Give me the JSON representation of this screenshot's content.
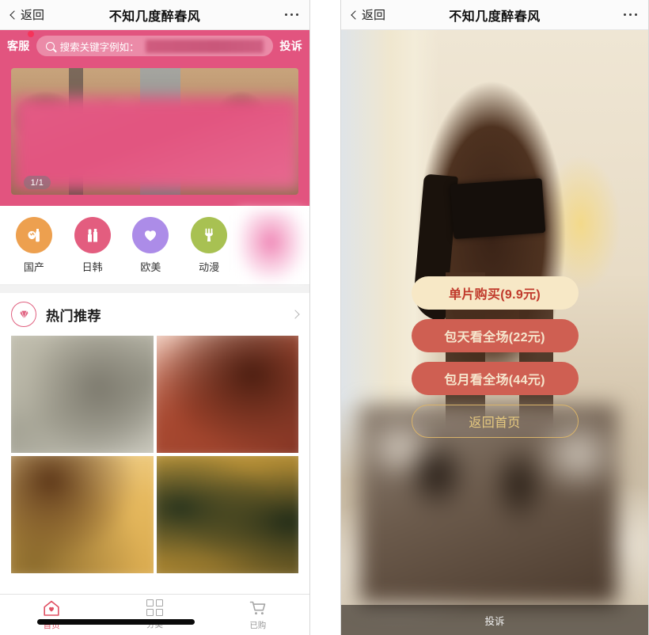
{
  "left_panel": {
    "nav": {
      "back_label": "返回",
      "title": "不知几度醉春风",
      "more_icon": "more-dots-icon"
    },
    "search_strip": {
      "service_label": "客服",
      "search_placeholder": "搜索关键字例如：",
      "complaint_label": "投诉",
      "search_icon": "search-icon",
      "badge_visible": true
    },
    "banner": {
      "pager_text": "1/1"
    },
    "categories": [
      {
        "label": "国产",
        "color": "#eda04f",
        "icon": "bottle-icon"
      },
      {
        "label": "日韩",
        "color": "#e35d7f",
        "icon": "lipstick-icon"
      },
      {
        "label": "欧美",
        "color": "#ac8ce8",
        "icon": "heart-icon"
      },
      {
        "label": "动漫",
        "color": "#a8c152",
        "icon": "fork-icon"
      }
    ],
    "hot_section": {
      "title": "热门推荐",
      "icon": "diamond-icon",
      "chevron_icon": "chevron-right-icon"
    },
    "tabs": [
      {
        "label": "首页",
        "icon": "home-heart-icon",
        "active": true
      },
      {
        "label": "分类",
        "icon": "grid-icon",
        "active": false
      },
      {
        "label": "已购",
        "icon": "cart-icon",
        "active": false
      }
    ]
  },
  "right_panel": {
    "nav": {
      "back_label": "返回",
      "title": "不知几度醉春风",
      "more_icon": "more-dots-icon"
    },
    "buttons": [
      {
        "label": "单片购买(9.9元)",
        "style": "cream"
      },
      {
        "label": "包天看全场(22元)",
        "style": "red"
      },
      {
        "label": "包月看全场(44元)",
        "style": "red"
      },
      {
        "label": "返回首页",
        "style": "ghost"
      }
    ],
    "bottom_bar": {
      "label": "投诉"
    }
  },
  "colors": {
    "brand_pink": "#e2547f",
    "accent_red": "#e05063",
    "cream": "#f7e8c6",
    "button_red": "#cf5f52",
    "gold": "#d9b36a"
  }
}
